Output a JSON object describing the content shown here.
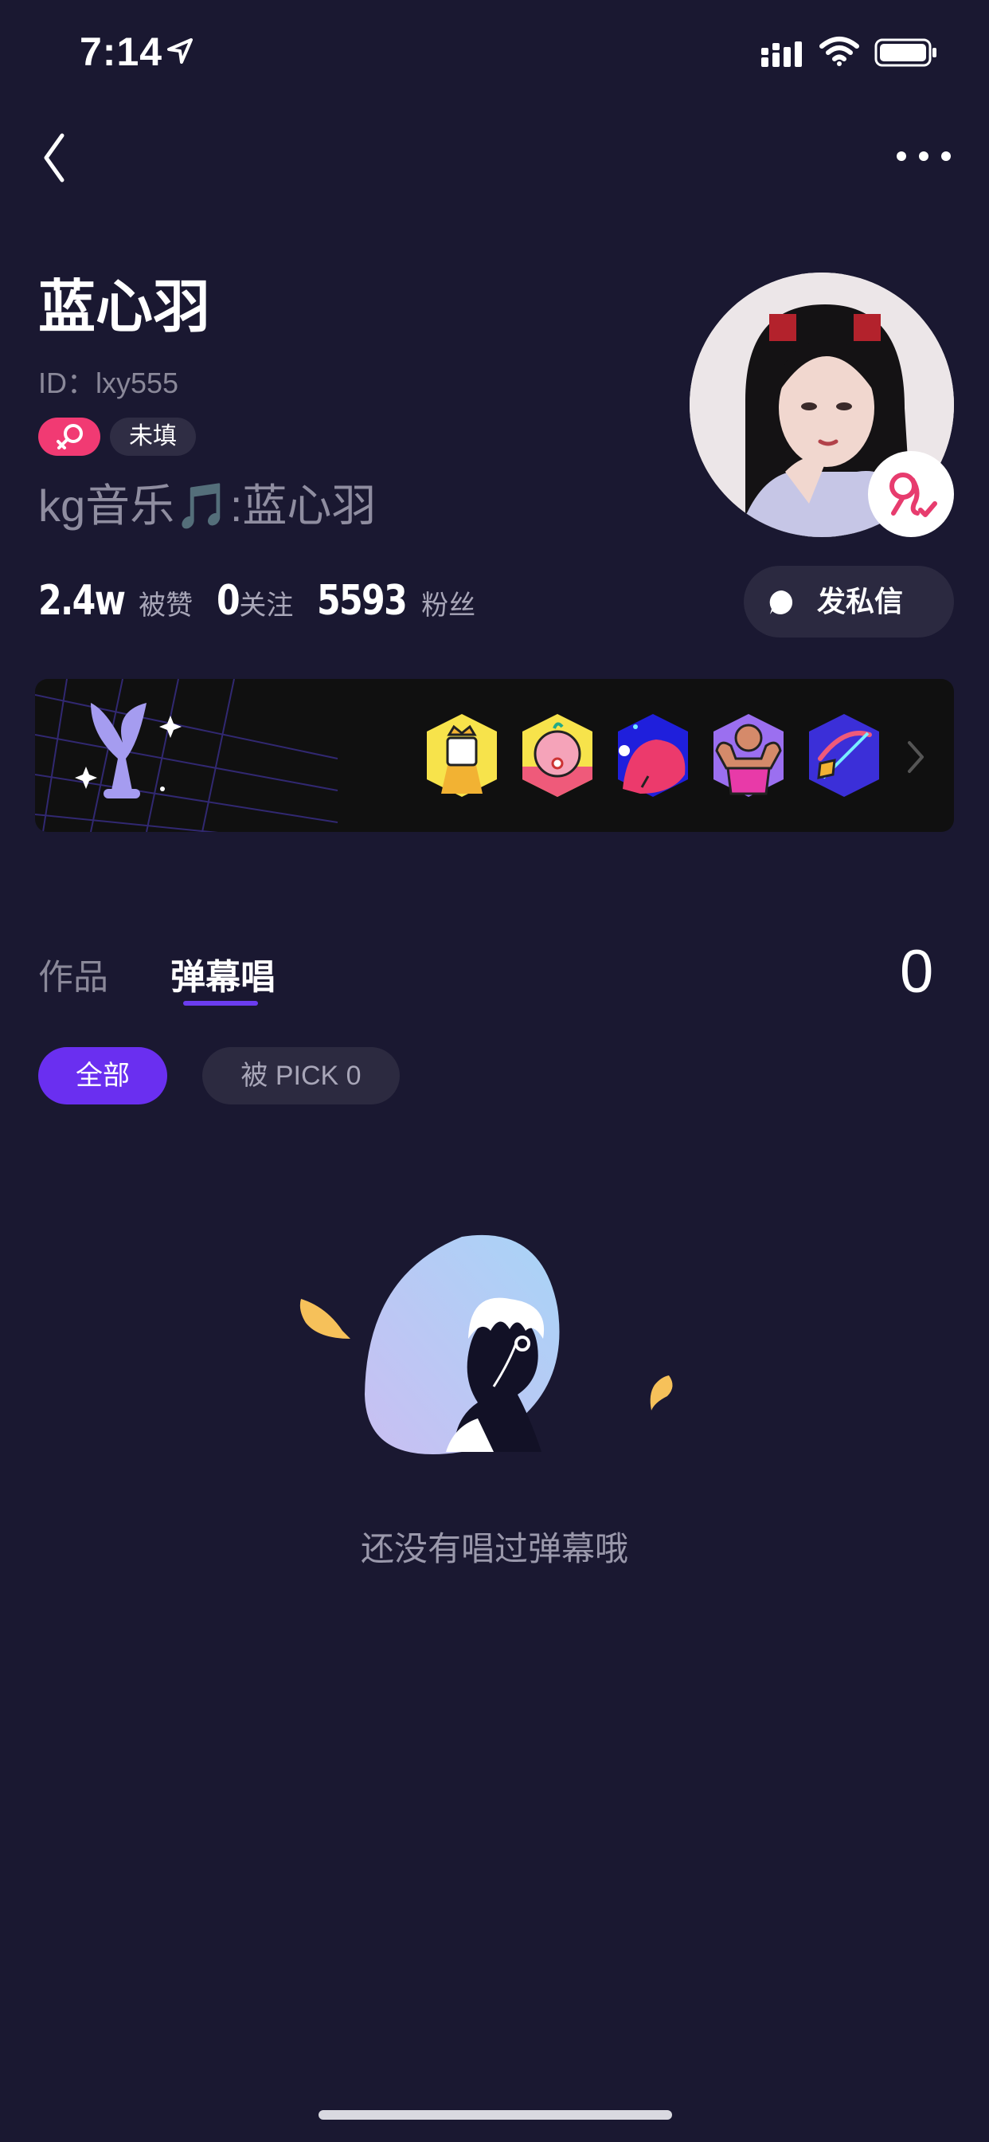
{
  "status_bar": {
    "time": "7:14",
    "icons": [
      "location-arrow-icon",
      "signal-icon",
      "wifi-icon",
      "battery-icon"
    ]
  },
  "nav": {
    "back_icon": "chevron-left-icon",
    "more_icon": "ellipsis-icon"
  },
  "profile": {
    "name": "蓝心羽",
    "id_text": "ID：lxy555",
    "gender_tag_icon": "female-icon",
    "unfilled_tag": "未填",
    "signature": "kg音乐🎵:蓝心羽",
    "zodiac_icon": "leo-zodiac-icon"
  },
  "stats": [
    {
      "value": "2.4w",
      "label": "被赞"
    },
    {
      "value": "0",
      "label": "关注"
    },
    {
      "value": "5593",
      "label": "粉丝"
    }
  ],
  "message_button": {
    "label": "发私信",
    "icon": "chat-bubble-icon"
  },
  "medal_banner": {
    "trophy_icon": "mermaid-tail-trophy-icon",
    "medals": [
      "king-medal-icon",
      "girl-medal-icon",
      "red-creature-medal-icon",
      "strongman-medal-icon",
      "cupid-bow-medal-icon"
    ],
    "arrow_icon": "chevron-right-icon"
  },
  "tabs": {
    "items": [
      {
        "label": "作品",
        "active": false
      },
      {
        "label": "弹幕唱",
        "active": true
      }
    ],
    "count": "0"
  },
  "filters": {
    "all": "全部",
    "pick": "被 PICK 0"
  },
  "empty_state": {
    "message": "还没有唱过弹幕哦"
  },
  "colors": {
    "background": "#1a1831",
    "accent": "#6a2ff0",
    "gender_pink": "#f13a73"
  }
}
